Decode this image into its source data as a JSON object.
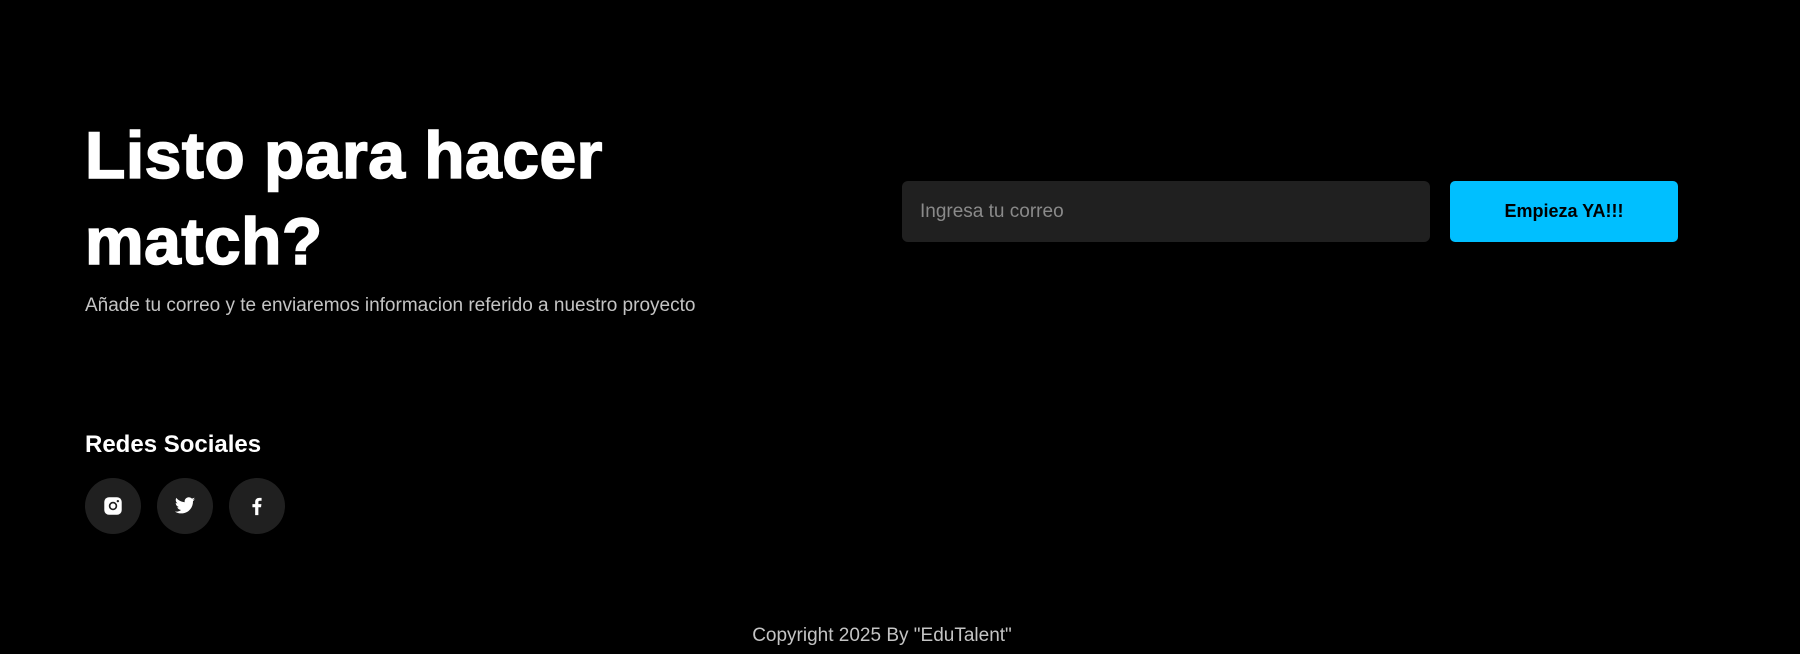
{
  "hero": {
    "title": "Listo para hacer match?",
    "subtitle": "Añade tu correo y te enviaremos informacion referido a nuestro proyecto"
  },
  "signup": {
    "email_placeholder": "Ingresa tu correo",
    "email_value": "",
    "button_label": "Empieza YA!!!"
  },
  "social": {
    "title": "Redes Sociales",
    "icons": [
      "instagram-icon",
      "twitter-icon",
      "facebook-icon"
    ]
  },
  "footer": {
    "copyright": "Copyright 2025 By \"EduTalent\""
  },
  "colors": {
    "background": "#000000",
    "accent": "#00bfff",
    "input_background": "#202020",
    "muted_text": "#c4c4c4"
  }
}
